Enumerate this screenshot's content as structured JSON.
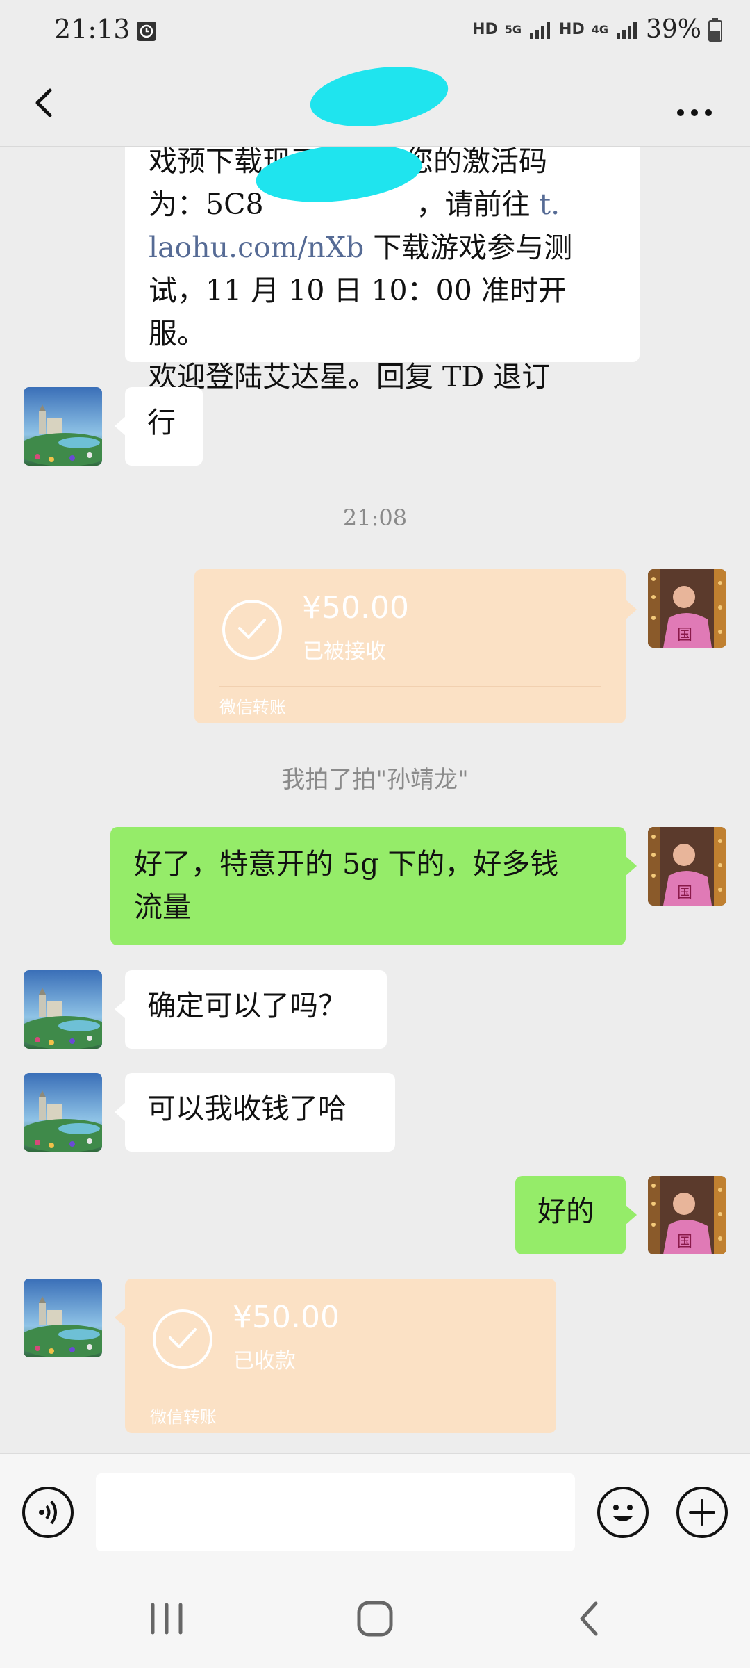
{
  "status_bar": {
    "time": "21:13",
    "network_1": "HD",
    "network_2": "5G",
    "network_3": "HD",
    "network_4": "4G",
    "battery": "39%"
  },
  "header": {
    "title": "→"
  },
  "messages": {
    "msg1": {
      "line1": "戏预下载现已开启，您的激活码",
      "line2_pre": "为：5C8",
      "line2_post": "，请前往 ",
      "line2_link": "t.",
      "line3_link": "laohu.com/nXb",
      "line3_post": " 下载游戏参与测",
      "line4": "试，11 月 10 日 10：00 准时开服。",
      "line5": "欢迎登陆艾达星。回复 TD 退订"
    },
    "msg2": "行",
    "time_divider": "21:08",
    "transfer1": {
      "amount": "¥50.00",
      "status": "已被接收",
      "footer": "微信转账"
    },
    "pat_notice": "我拍了拍\"孙靖龙\"",
    "msg3_line1": "好了，特意开的 5g 下的，好多钱",
    "msg3_line2": "流量",
    "msg4": "确定可以了吗？",
    "msg5": "可以我收钱了哈",
    "msg6": "好的",
    "transfer2": {
      "amount": "¥50.00",
      "status": "已收款",
      "footer": "微信转账"
    }
  },
  "input": {
    "placeholder": ""
  },
  "colors": {
    "background": "#ededed",
    "green_bubble": "#95ec69",
    "transfer": "#fbe1c5",
    "redaction": "#1fe4ee",
    "link": "#566b95"
  }
}
